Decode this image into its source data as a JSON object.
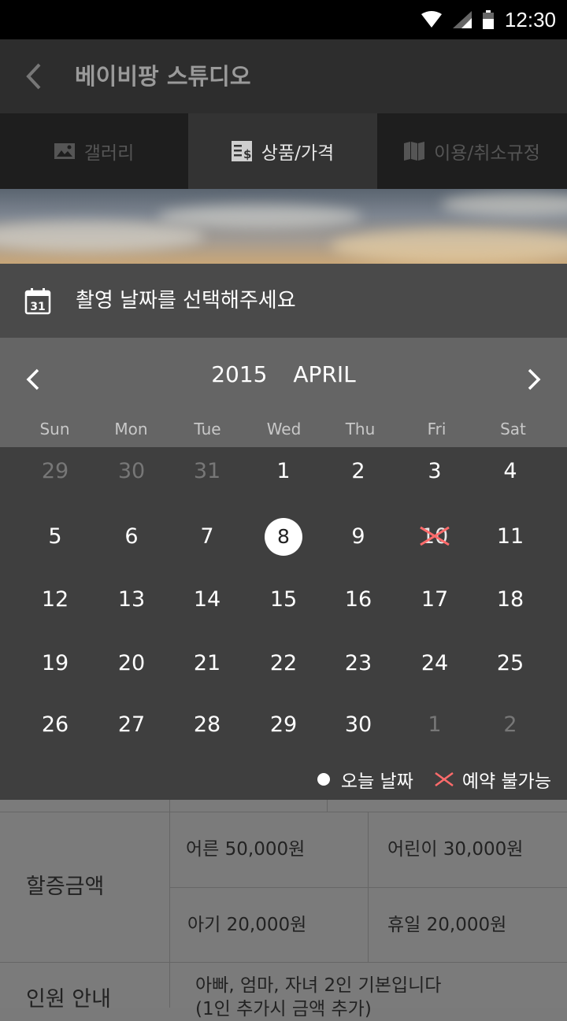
{
  "status_bar": {
    "time": "12:30"
  },
  "app_bar": {
    "title": "베이비팡 스튜디오"
  },
  "tabs": [
    {
      "label": "갤러리",
      "icon": "image-icon",
      "active": false
    },
    {
      "label": "상품/가격",
      "icon": "receipt-dollar-icon",
      "active": true
    },
    {
      "label": "이용/취소규정",
      "icon": "map-book-icon",
      "active": false
    }
  ],
  "date_picker": {
    "header": "촬영 날짜를 선택해주세요",
    "year": "2015",
    "month": "APRIL",
    "weekdays": [
      "Sun",
      "Mon",
      "Tue",
      "Wed",
      "Thu",
      "Fri",
      "Sat"
    ],
    "weeks": [
      [
        "29",
        "30",
        "31",
        "1",
        "2",
        "3",
        "4"
      ],
      [
        "5",
        "6",
        "7",
        "8",
        "9",
        "10",
        "11"
      ],
      [
        "12",
        "13",
        "14",
        "15",
        "16",
        "17",
        "18"
      ],
      [
        "19",
        "20",
        "21",
        "22",
        "23",
        "24",
        "25"
      ],
      [
        "26",
        "27",
        "28",
        "29",
        "30",
        "1",
        "2"
      ]
    ],
    "today": "8",
    "unavailable": [
      "10"
    ],
    "legend": {
      "today_label": "오늘 날짜",
      "unavailable_label": "예약 불가능"
    },
    "colors": {
      "unavailable_mark": "#ff6b6b"
    }
  },
  "price_table": {
    "surcharge_label": "할증금액",
    "adult": "어른  50,000원",
    "child": "어린이  30,000원",
    "baby": "아기  20,000원",
    "holiday": "휴일  20,000원",
    "people_label": "인원 안내",
    "people_info_line1": "아빠, 엄마, 자녀 2인 기본입니다",
    "people_info_line2": "(1인 추가시 금액 추가)"
  }
}
